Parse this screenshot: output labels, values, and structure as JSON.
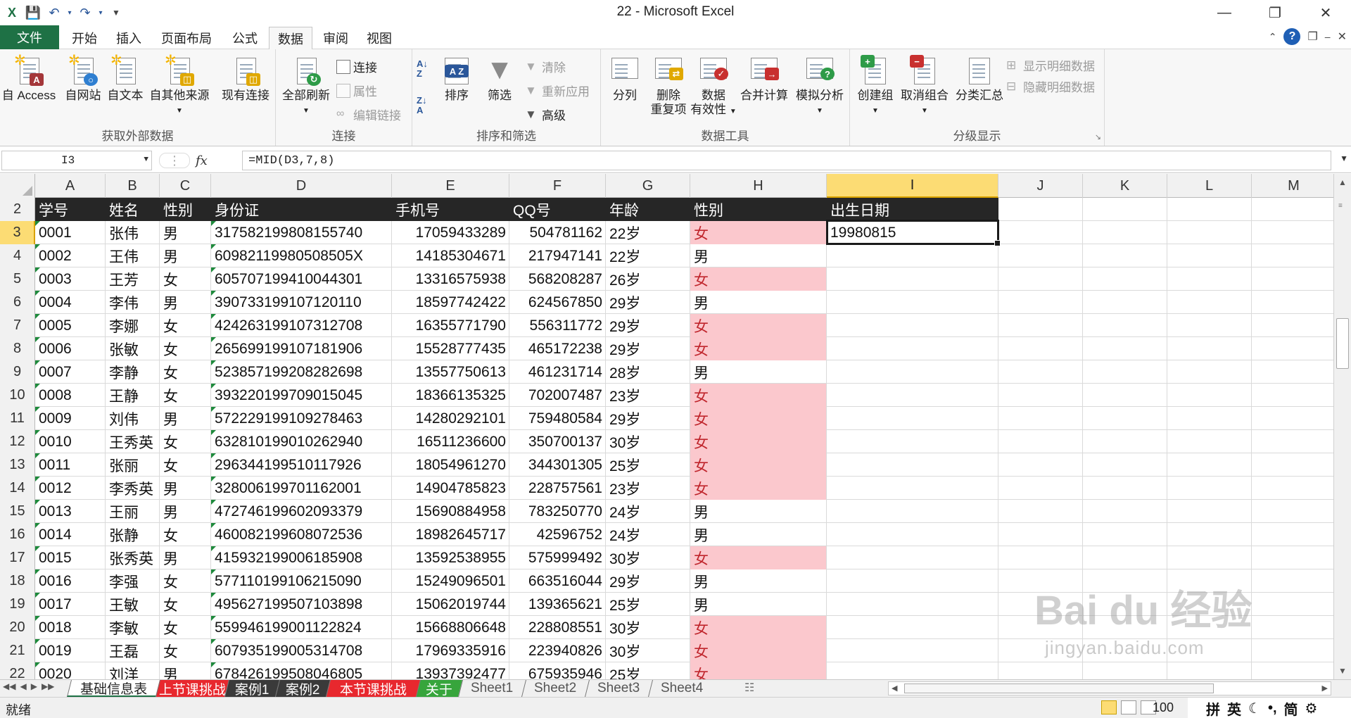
{
  "window": {
    "title": "22 - Microsoft Excel"
  },
  "tabs": [
    {
      "label": "文件",
      "file": true
    },
    {
      "label": "开始"
    },
    {
      "label": "插入"
    },
    {
      "label": "页面布局"
    },
    {
      "label": "公式"
    },
    {
      "label": "数据",
      "active": true
    },
    {
      "label": "审阅"
    },
    {
      "label": "视图"
    }
  ],
  "ribbon": {
    "groups": [
      {
        "label": "获取外部数据"
      },
      {
        "label": "连接"
      },
      {
        "label": "排序和筛选"
      },
      {
        "label": "数据工具"
      },
      {
        "label": "分级显示"
      }
    ],
    "access": "自 Access",
    "web": "自网站",
    "text": "自文本",
    "other": "自其他来源",
    "existing": "现有连接",
    "refresh": "全部刷新",
    "connections": "连接",
    "properties": "属性",
    "editlinks": "编辑链接",
    "sort": "排序",
    "filter": "筛选",
    "clear": "清除",
    "reapply": "重新应用",
    "advanced": "高级",
    "split": "分列",
    "dedupe1": "删除",
    "dedupe2": "重复项",
    "validate1": "数据",
    "validate2": "有效性",
    "consolidate": "合并计算",
    "whatif": "模拟分析",
    "group": "创建组",
    "ungroup": "取消组合",
    "subtotal": "分类汇总",
    "showdetail": "显示明细数据",
    "hidedetail": "隐藏明细数据"
  },
  "formula_bar": {
    "name_box": "I3",
    "fx": "fx",
    "formula": "=MID(D3,7,8)"
  },
  "columns": [
    "A",
    "B",
    "C",
    "D",
    "E",
    "F",
    "G",
    "H",
    "I",
    "J",
    "K",
    "L",
    "M"
  ],
  "selected_column": "I",
  "selected_row": "3",
  "header_row": {
    "row": "2",
    "cells": [
      "学号",
      "姓名",
      "性别",
      "身份证",
      "手机号",
      "QQ号",
      "年龄",
      "性别",
      "出生日期"
    ]
  },
  "rows": [
    {
      "row": "3",
      "id": "0001",
      "name": "张伟",
      "sex": "男",
      "idcard": "317582199808155740",
      "phone": "17059433289",
      "qq": "504781162",
      "age": "22岁",
      "sex2": "女",
      "birth": "19980815"
    },
    {
      "row": "4",
      "id": "0002",
      "name": "王伟",
      "sex": "男",
      "idcard": "60982119980508505X",
      "phone": "14185304671",
      "qq": "217947141",
      "age": "22岁",
      "sex2": "男",
      "birth": ""
    },
    {
      "row": "5",
      "id": "0003",
      "name": "王芳",
      "sex": "女",
      "idcard": "605707199410044301",
      "phone": "13316575938",
      "qq": "568208287",
      "age": "26岁",
      "sex2": "女",
      "birth": ""
    },
    {
      "row": "6",
      "id": "0004",
      "name": "李伟",
      "sex": "男",
      "idcard": "390733199107120110",
      "phone": "18597742422",
      "qq": "624567850",
      "age": "29岁",
      "sex2": "男",
      "birth": ""
    },
    {
      "row": "7",
      "id": "0005",
      "name": "李娜",
      "sex": "女",
      "idcard": "424263199107312708",
      "phone": "16355771790",
      "qq": "556311772",
      "age": "29岁",
      "sex2": "女",
      "birth": ""
    },
    {
      "row": "8",
      "id": "0006",
      "name": "张敏",
      "sex": "女",
      "idcard": "265699199107181906",
      "phone": "15528777435",
      "qq": "465172238",
      "age": "29岁",
      "sex2": "女",
      "birth": ""
    },
    {
      "row": "9",
      "id": "0007",
      "name": "李静",
      "sex": "女",
      "idcard": "523857199208282698",
      "phone": "13557750613",
      "qq": "461231714",
      "age": "28岁",
      "sex2": "男",
      "birth": ""
    },
    {
      "row": "10",
      "id": "0008",
      "name": "王静",
      "sex": "女",
      "idcard": "393220199709015045",
      "phone": "18366135325",
      "qq": "702007487",
      "age": "23岁",
      "sex2": "女",
      "birth": ""
    },
    {
      "row": "11",
      "id": "0009",
      "name": "刘伟",
      "sex": "男",
      "idcard": "572229199109278463",
      "phone": "14280292101",
      "qq": "759480584",
      "age": "29岁",
      "sex2": "女",
      "birth": ""
    },
    {
      "row": "12",
      "id": "0010",
      "name": "王秀英",
      "sex": "女",
      "idcard": "632810199010262940",
      "phone": "16511236600",
      "qq": "350700137",
      "age": "30岁",
      "sex2": "女",
      "birth": ""
    },
    {
      "row": "13",
      "id": "0011",
      "name": "张丽",
      "sex": "女",
      "idcard": "296344199510117926",
      "phone": "18054961270",
      "qq": "344301305",
      "age": "25岁",
      "sex2": "女",
      "birth": ""
    },
    {
      "row": "14",
      "id": "0012",
      "name": "李秀英",
      "sex": "男",
      "idcard": "328006199701162001",
      "phone": "14904785823",
      "qq": "228757561",
      "age": "23岁",
      "sex2": "女",
      "birth": ""
    },
    {
      "row": "15",
      "id": "0013",
      "name": "王丽",
      "sex": "男",
      "idcard": "472746199602093379",
      "phone": "15690884958",
      "qq": "783250770",
      "age": "24岁",
      "sex2": "男",
      "birth": ""
    },
    {
      "row": "16",
      "id": "0014",
      "name": "张静",
      "sex": "女",
      "idcard": "460082199608072536",
      "phone": "18982645717",
      "qq": "42596752",
      "age": "24岁",
      "sex2": "男",
      "birth": ""
    },
    {
      "row": "17",
      "id": "0015",
      "name": "张秀英",
      "sex": "男",
      "idcard": "415932199006185908",
      "phone": "13592538955",
      "qq": "575999492",
      "age": "30岁",
      "sex2": "女",
      "birth": ""
    },
    {
      "row": "18",
      "id": "0016",
      "name": "李强",
      "sex": "女",
      "idcard": "577110199106215090",
      "phone": "15249096501",
      "qq": "663516044",
      "age": "29岁",
      "sex2": "男",
      "birth": ""
    },
    {
      "row": "19",
      "id": "0017",
      "name": "王敏",
      "sex": "女",
      "idcard": "495627199507103898",
      "phone": "15062019744",
      "qq": "139365621",
      "age": "25岁",
      "sex2": "男",
      "birth": ""
    },
    {
      "row": "20",
      "id": "0018",
      "name": "李敏",
      "sex": "女",
      "idcard": "559946199001122824",
      "phone": "15668806648",
      "qq": "228808551",
      "age": "30岁",
      "sex2": "女",
      "birth": ""
    },
    {
      "row": "21",
      "id": "0019",
      "name": "王磊",
      "sex": "女",
      "idcard": "607935199005314708",
      "phone": "17969335916",
      "qq": "223940826",
      "age": "30岁",
      "sex2": "女",
      "birth": ""
    },
    {
      "row": "22",
      "id": "0020",
      "name": "刘洋",
      "sex": "男",
      "idcard": "678426199508046805",
      "phone": "13937392477",
      "qq": "675935946",
      "age": "25岁",
      "sex2": "女",
      "birth": ""
    }
  ],
  "sheets": [
    {
      "label": "基础信息表",
      "active": true,
      "color": "#ffffff",
      "text": "#222222"
    },
    {
      "label": "上节课挑战",
      "color": "#e8282e",
      "text": "#ffffff"
    },
    {
      "label": "案例1",
      "color": "#3a3a3a",
      "text": "#ffffff"
    },
    {
      "label": "案例2",
      "color": "#3a3a3a",
      "text": "#ffffff"
    },
    {
      "label": "本节课挑战",
      "color": "#e8282e",
      "text": "#ffffff"
    },
    {
      "label": "关于",
      "color": "#37a53c",
      "text": "#ffffff"
    },
    {
      "label": "Sheet1",
      "color": "#f0f0f0",
      "text": "#555555"
    },
    {
      "label": "Sheet2",
      "color": "#f0f0f0",
      "text": "#555555"
    },
    {
      "label": "Sheet3",
      "color": "#f0f0f0",
      "text": "#555555"
    },
    {
      "label": "Sheet4",
      "color": "#f0f0f0",
      "text": "#555555"
    }
  ],
  "status": {
    "ready": "就绪",
    "zoom": "100",
    "ime": [
      "拼",
      "英",
      "简"
    ]
  },
  "watermark": {
    "brand": "Bai du 经验",
    "url": "jingyan.baidu.com"
  },
  "colors": {
    "accent": "#1e7145",
    "header_fill": "#262626",
    "female_fill": "#fbc8cd",
    "female_text": "#c0262d",
    "selection": "#fcdc74"
  }
}
